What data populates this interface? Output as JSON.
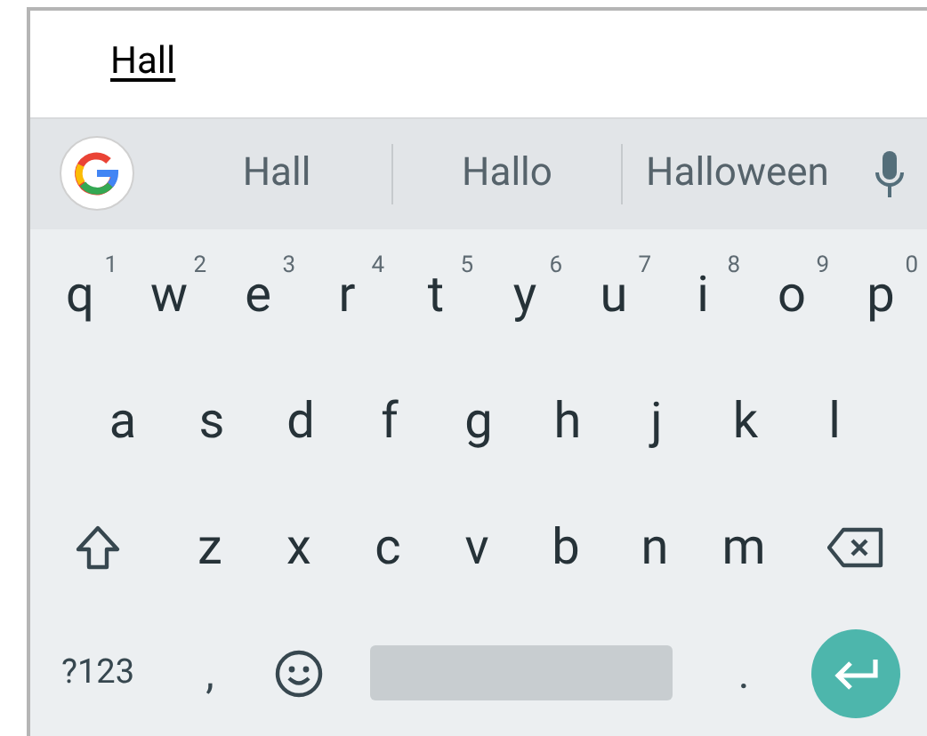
{
  "input": {
    "value": "Hall"
  },
  "suggestions": [
    "Hall",
    "Hallo",
    "Halloween"
  ],
  "rows": [
    [
      {
        "label": "q",
        "hint": "1"
      },
      {
        "label": "w",
        "hint": "2"
      },
      {
        "label": "e",
        "hint": "3"
      },
      {
        "label": "r",
        "hint": "4"
      },
      {
        "label": "t",
        "hint": "5"
      },
      {
        "label": "y",
        "hint": "6"
      },
      {
        "label": "u",
        "hint": "7"
      },
      {
        "label": "i",
        "hint": "8"
      },
      {
        "label": "o",
        "hint": "9"
      },
      {
        "label": "p",
        "hint": "0"
      }
    ],
    [
      {
        "label": "a"
      },
      {
        "label": "s"
      },
      {
        "label": "d"
      },
      {
        "label": "f"
      },
      {
        "label": "g"
      },
      {
        "label": "h"
      },
      {
        "label": "j"
      },
      {
        "label": "k"
      },
      {
        "label": "l"
      }
    ],
    [
      {
        "label": "z"
      },
      {
        "label": "x"
      },
      {
        "label": "c"
      },
      {
        "label": "v"
      },
      {
        "label": "b"
      },
      {
        "label": "n"
      },
      {
        "label": "m"
      }
    ]
  ],
  "bottom_row": [
    {
      "kind": "symbols",
      "label": "?123"
    },
    {
      "kind": "char",
      "label": ","
    },
    {
      "kind": "emoji"
    },
    {
      "kind": "space"
    },
    {
      "kind": "char",
      "label": "."
    },
    {
      "kind": "enter"
    }
  ]
}
